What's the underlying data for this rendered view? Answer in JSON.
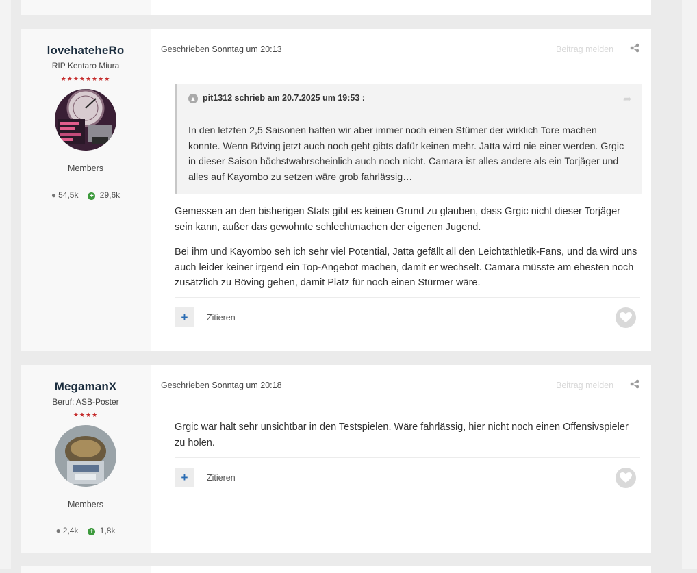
{
  "posts": [
    {
      "author": "lovehateheRo",
      "author_title": "RIP Kentaro Miura",
      "stars": "★★★★★★★★",
      "group": "Members",
      "comment_count": "54,5k",
      "reputation": "29,6k",
      "written_label": "Geschrieben",
      "date": "Sonntag um 20:13",
      "report_label": "Beitrag melden",
      "quote": {
        "header": "pit1312 schrieb am 20.7.2025 um 19:53 :",
        "text": "In den letzten 2,5 Saisonen hatten wir aber immer noch einen Stümer der wirklich Tore machen konnte. Wenn Böving jetzt auch noch geht gibts dafür keinen mehr. Jatta wird nie einer werden. Grgic in dieser Saison höchstwahrscheinlich auch noch nicht. Camara ist alles andere als ein Torjäger und alles auf Kayombo zu setzen wäre grob fahrlässig…"
      },
      "paragraphs": [
        "Gemessen an den bisherigen Stats gibt es keinen Grund zu glauben, dass Grgic nicht dieser Torjäger sein kann, außer das gewohnte schlechtmachen der eigenen Jugend.",
        "Bei ihm und Kayombo seh ich sehr viel Potential, Jatta gefällt all den Leichtathletik-Fans, und da wird uns auch leider keiner irgend ein Top-Angebot machen, damit er wechselt. Camara müsste am ehesten noch zusätzlich zu Böving gehen, damit Platz für noch einen Stürmer wäre."
      ],
      "quote_label": "Zitieren",
      "multiquote_label": "+"
    },
    {
      "author": "MegamanX",
      "author_title": "Beruf: ASB-Poster",
      "stars": "★★★★",
      "group": "Members",
      "comment_count": "2,4k",
      "reputation": "1,8k",
      "written_label": "Geschrieben",
      "date": "Sonntag um 20:18",
      "report_label": "Beitrag melden",
      "paragraphs": [
        "Grgic war halt sehr unsichtbar in den Testspielen. Wäre fahrlässig, hier nicht noch einen Offensivspieler zu holen."
      ],
      "quote_label": "Zitieren",
      "multiquote_label": "+"
    }
  ],
  "colors": {
    "page_bg": "#ebebeb",
    "author_name": "#1b2d3e",
    "stars": "#c52c2c",
    "reputation_icon": "#3d9a3d",
    "multiquote_icon": "#2a6cb3"
  },
  "icons": [
    "comment-icon",
    "plus-circle-icon",
    "share-icon",
    "collapse-icon",
    "reply-arrow-icon",
    "heart-icon"
  ]
}
